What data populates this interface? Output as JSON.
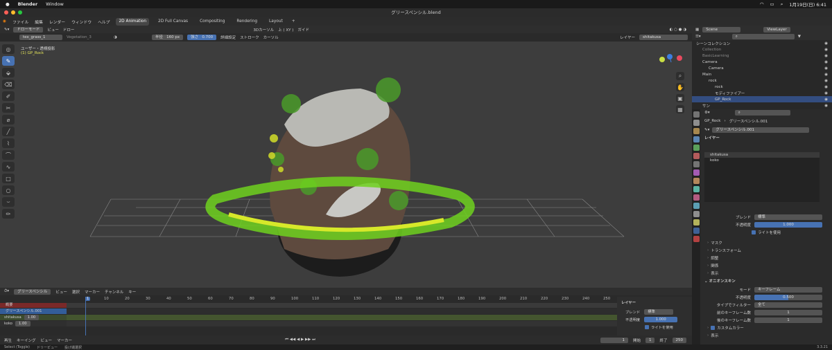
{
  "mac": {
    "apple": "",
    "app": "Blender",
    "menu": "Window",
    "clock": "1月19日(日) 6:41"
  },
  "window_title": "グリースペンシル.blend",
  "workspaces": [
    "2D Animation",
    "2D Full Canvas",
    "Compositing",
    "Rendering",
    "Layout"
  ],
  "workspace_add": "+",
  "menus": [
    "ファイル",
    "編集",
    "レンダー",
    "ウィンドウ",
    "ヘルプ"
  ],
  "viewport_header": {
    "mode": "ドローモード",
    "view": "ビュー",
    "draw": "ドロー",
    "cursor": "3Dカーソル",
    "axis": "上 ( XY )",
    "guide": "ガイド"
  },
  "toolsettings": {
    "brush": "tex_grass_1",
    "material": "Vegetation_3",
    "color_hex": "#1b9e1b",
    "radius_label": "半径",
    "radius_value": "160 px",
    "strength_label": "強さ",
    "strength_value": "0.700",
    "advanced": "詳細設定",
    "stroke": "ストローク",
    "cursor": "カーソル",
    "layer_label": "レイヤー",
    "layer_value": "shitakusa"
  },
  "viewport": {
    "projection": "ユーザー・透視投影",
    "object": "(1) GP_Rock"
  },
  "timeline": {
    "header": [
      "ビュー",
      "選択",
      "マーカー",
      "チャンネル",
      "キー"
    ],
    "mode": "グリースペンシル",
    "ticks": [
      "1",
      "10",
      "20",
      "30",
      "40",
      "50",
      "60",
      "70",
      "80",
      "90",
      "100",
      "110",
      "120",
      "130",
      "140",
      "150",
      "160",
      "170",
      "180",
      "190",
      "200",
      "210",
      "220",
      "230",
      "240",
      "250"
    ],
    "summary": "概要",
    "gp_name": "グリースペンシル.001",
    "layers": [
      {
        "name": "shitakusa",
        "value": "1.00"
      },
      {
        "name": "koko",
        "value": "1.00"
      }
    ],
    "side": {
      "title": "レイヤー",
      "blend_label": "ブレンド",
      "blend_value": "標準",
      "opacity_label": "不透明度",
      "opacity_value": "1.000",
      "lights": "ライトを使用"
    }
  },
  "playbar": {
    "items": [
      "再生",
      "キーイング",
      "ビュー",
      "マーカー"
    ],
    "current": "1",
    "start_label": "開始",
    "start": "1",
    "end_label": "終了",
    "end": "250"
  },
  "status": {
    "select": "Select (Toggle)",
    "dolly": "ドリービュー",
    "lasso": "投げ縄選択",
    "version": "3.3.21"
  },
  "outliner": {
    "scene": "Scene",
    "viewlayer": "ViewLayer",
    "rows": [
      {
        "label": "シーンコレクション",
        "indent": 0,
        "muted": false
      },
      {
        "label": "Collection",
        "indent": 1,
        "muted": true
      },
      {
        "label": "BasicLearning",
        "indent": 1,
        "muted": true
      },
      {
        "label": "Camera",
        "indent": 1,
        "muted": false
      },
      {
        "label": "Camera",
        "indent": 2,
        "muted": false
      },
      {
        "label": "Main",
        "indent": 1,
        "muted": false
      },
      {
        "label": "rock",
        "indent": 2,
        "muted": false
      },
      {
        "label": "rock",
        "indent": 3,
        "muted": false
      },
      {
        "label": "モディファイアー",
        "indent": 3,
        "muted": false
      },
      {
        "label": "GP_Rock",
        "indent": 3,
        "muted": false,
        "selected": true
      },
      {
        "label": "サン",
        "indent": 1,
        "muted": false
      }
    ]
  },
  "properties": {
    "breadcrumb_obj": "GP_Rock",
    "breadcrumb_data": "グリースペンシル.001",
    "datablock": "グリースペンシル.001",
    "layers_title": "レイヤー",
    "layers": [
      "shitakusa",
      "koko"
    ],
    "blend_label": "ブレンド",
    "blend_value": "標準",
    "opacity_label": "不透明度",
    "opacity_value": "1.000",
    "lights": "ライトを使用",
    "collapsed": [
      "マスク",
      "トランスフォーム",
      "調整",
      "関係",
      "表示"
    ],
    "onion_title": "オニオンスキン",
    "onion_mode_label": "モード",
    "onion_mode_value": "キーフレーム",
    "onion_opacity_label": "不透明度",
    "onion_opacity_value": "0.500",
    "onion_filter_label": "タイプでフィルター",
    "onion_filter_value": "全て",
    "onion_before_label": "前のキーフレーム数",
    "onion_before_value": "1",
    "onion_after_label": "後のキーフレーム数",
    "onion_after_value": "1",
    "custom_colors": "カスタムカラー",
    "display": "表示"
  }
}
